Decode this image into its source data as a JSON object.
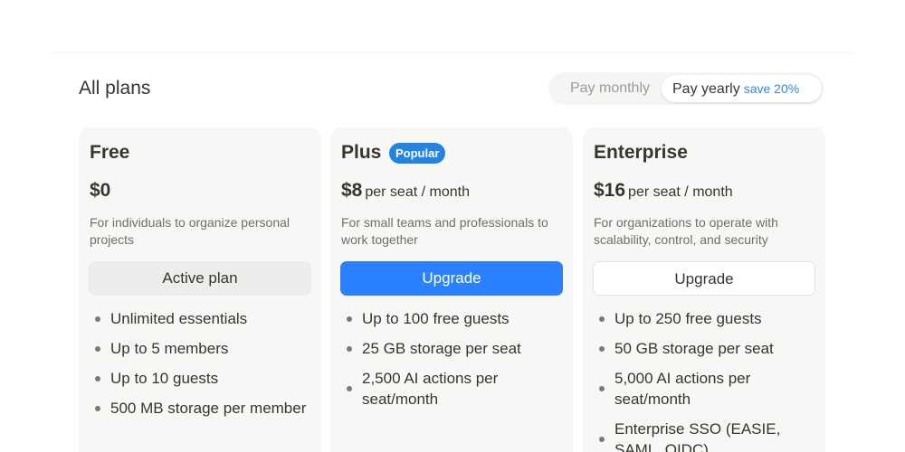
{
  "header": {
    "title": "All plans",
    "billing_toggle": {
      "monthly_label": "Pay monthly",
      "yearly_label": "Pay yearly",
      "yearly_badge": "save 20%",
      "selected": "yearly"
    }
  },
  "plans": [
    {
      "name": "Free",
      "price": "$0",
      "price_unit": "",
      "description": "For individuals to organize personal projects",
      "cta_label": "Active plan",
      "features": [
        "Unlimited essentials",
        "Up to 5 members",
        "Up to 10 guests",
        "500 MB storage per member"
      ]
    },
    {
      "name": "Plus",
      "badge": "Popular",
      "price": "$8",
      "price_unit": "per seat / month",
      "description": "For small teams and professionals to work together",
      "cta_label": "Upgrade",
      "features": [
        "Up to 100 free guests",
        "25 GB storage per seat",
        "2,500 AI actions per seat/month"
      ]
    },
    {
      "name": "Enterprise",
      "price": "$16",
      "price_unit": "per seat / month",
      "description": "For organizations to operate with scalability, control, and security",
      "cta_label": "Upgrade",
      "features": [
        "Up to 250 free guests",
        "50 GB storage per seat",
        "5,000 AI actions per seat/month",
        "Enterprise SSO (EASIE, SAML, OIDC)"
      ]
    }
  ],
  "colors": {
    "accent": "#2b80ff",
    "badge": "#2383e2",
    "save_text": "#2f8ae6",
    "card_bg": "#f7f7f6"
  }
}
